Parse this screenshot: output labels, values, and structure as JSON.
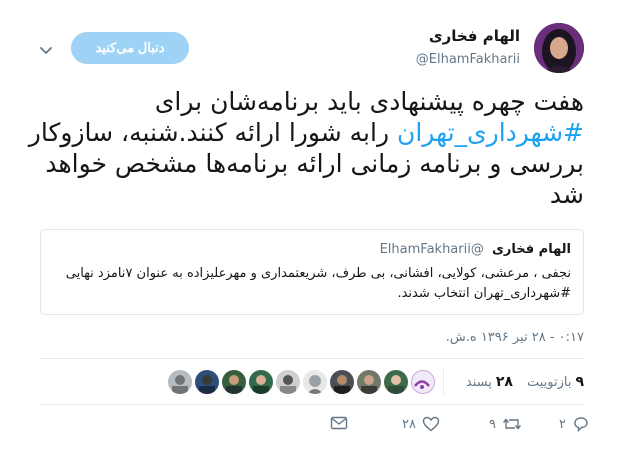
{
  "tweet": {
    "display_name": "الهام فخاری",
    "handle": "@ElhamFakharii",
    "follow_label": "دنبال می‌کنید",
    "text_before": "هفت چهره پیشنهادی باید برنامه‌شان برای ",
    "hashtag": "#شهرداری_تهران",
    "text_after": " رابه شورا ارائه کنند.شنبه، سازوکار بررسی و برنامه زمانی ارائه برنامه‌ها مشخص خواهد شد",
    "timestamp": "۰:۱۷ - ۲۸ تیر ۱۳۹۶ ه.ش."
  },
  "quote": {
    "name": "الهام فخاری",
    "handle": "@ElhamFakharii",
    "text": "نجفی ، مرعشی، کولایی، افشانی، بی طرف، شریعتمداری و مهرعلیزاده به عنوان ۷نامزد نهایی #شهرداری_تهران انتخاب شدند."
  },
  "stats": {
    "retweets_count": "۹",
    "retweets_label": "بازتوییت",
    "likes_count": "۲۸",
    "likes_label": "پسند"
  },
  "actions": {
    "reply_count": "۲",
    "retweet_count": "۹",
    "like_count": "۲۸"
  },
  "colors": {
    "accent": "#1da1f2",
    "follow_button": "#9fd3f6",
    "secondary_text": "#657786"
  }
}
